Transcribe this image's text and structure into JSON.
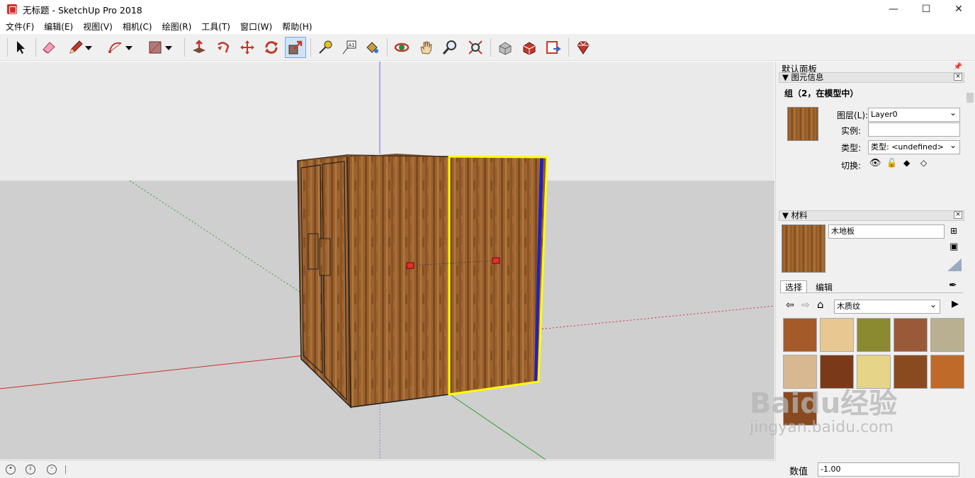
{
  "window": {
    "title": "无标题 - SketchUp Pro 2018",
    "minimize": "—",
    "maximize": "☐",
    "close": "✕"
  },
  "menu": [
    "文件(F)",
    "编辑(E)",
    "视图(V)",
    "相机(C)",
    "绘图(R)",
    "工具(T)",
    "窗口(W)",
    "帮助(H)"
  ],
  "toolbar": {
    "icons": [
      "select-arrow-icon",
      "eraser-icon",
      "pencil-line-icon",
      "arc-icon",
      "rectangle-icon",
      "push-pull-icon",
      "follow-me-icon",
      "move-icon",
      "rotate-icon",
      "scale-icon",
      "tape-measure-icon",
      "text-label-icon",
      "paint-bucket-icon",
      "orbit-icon",
      "pan-hand-icon",
      "zoom-icon",
      "zoom-extents-icon",
      "3d-warehouse-icon",
      "extension-warehouse-icon",
      "send-to-layout-icon",
      "extension-manager-icon"
    ],
    "active": "scale-icon"
  },
  "panel": {
    "title": "默认面板",
    "entity_info": {
      "header": "图元信息",
      "heading": "组（2，在模型中）",
      "layer_label": "图层(L):",
      "layer_value": "Layer0",
      "instance_label": "实例:",
      "instance_value": "",
      "type_label": "类型:",
      "type_value": "类型: <undefined>",
      "toggle_label": "切换:"
    },
    "materials": {
      "header": "材料",
      "name": "木地板",
      "tab_select": "选择",
      "tab_edit": "编辑",
      "library": "木质纹"
    }
  },
  "measurements": {
    "label": "数值",
    "value": "-1.00"
  },
  "watermark": {
    "brand": "Baidu经验",
    "url": "jingyan.baidu.com"
  },
  "colors": {
    "selection": "#ffff00",
    "accent": "#d62b2b",
    "wood": "#9b6230"
  }
}
